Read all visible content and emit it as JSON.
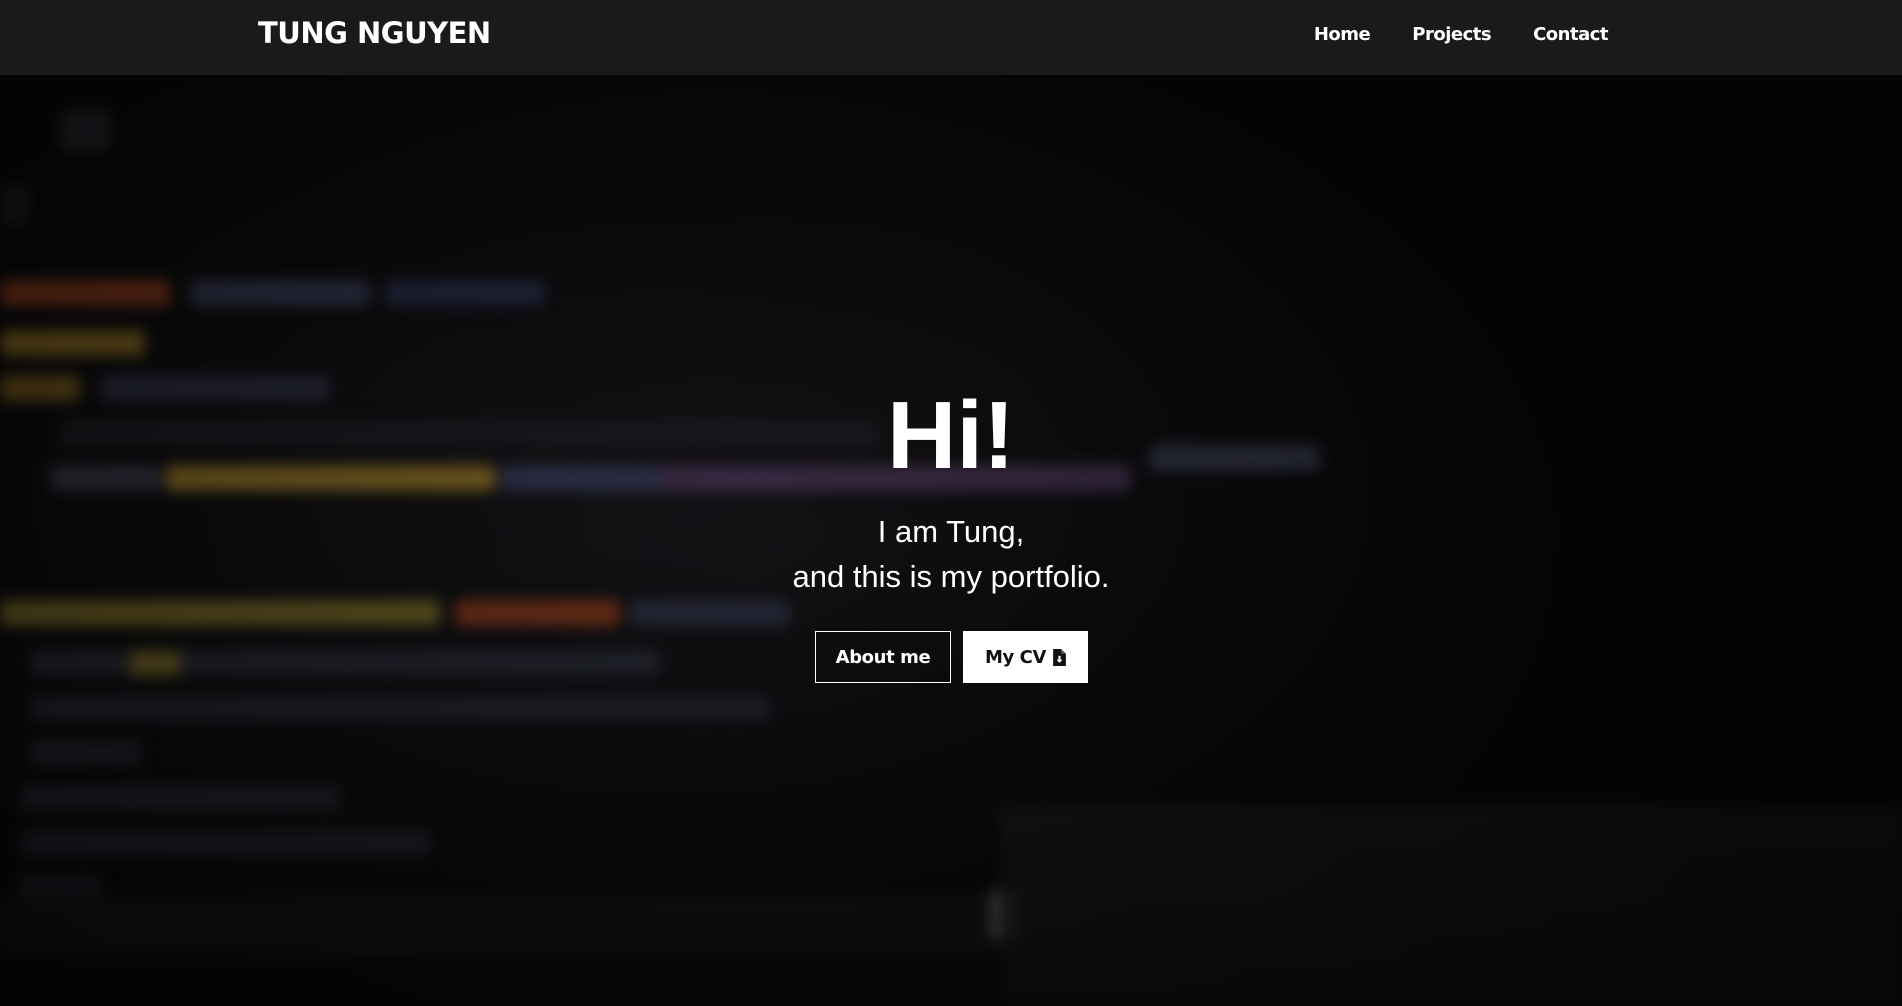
{
  "navbar": {
    "brand": "TUNG NGUYEN",
    "links": [
      {
        "label": "Home"
      },
      {
        "label": "Projects"
      },
      {
        "label": "Contact"
      }
    ]
  },
  "hero": {
    "greeting": "Hi!",
    "intro_line1": "I am Tung,",
    "intro_line2": "and this is my portfolio.",
    "buttons": {
      "about_label": "About me",
      "cv_label": "My CV",
      "cv_icon": "file-download-icon"
    }
  },
  "colors": {
    "navbar_bg": "#1b1a1b",
    "text": "#ffffff",
    "button_solid_bg": "#ffffff",
    "button_solid_text": "#111111"
  }
}
